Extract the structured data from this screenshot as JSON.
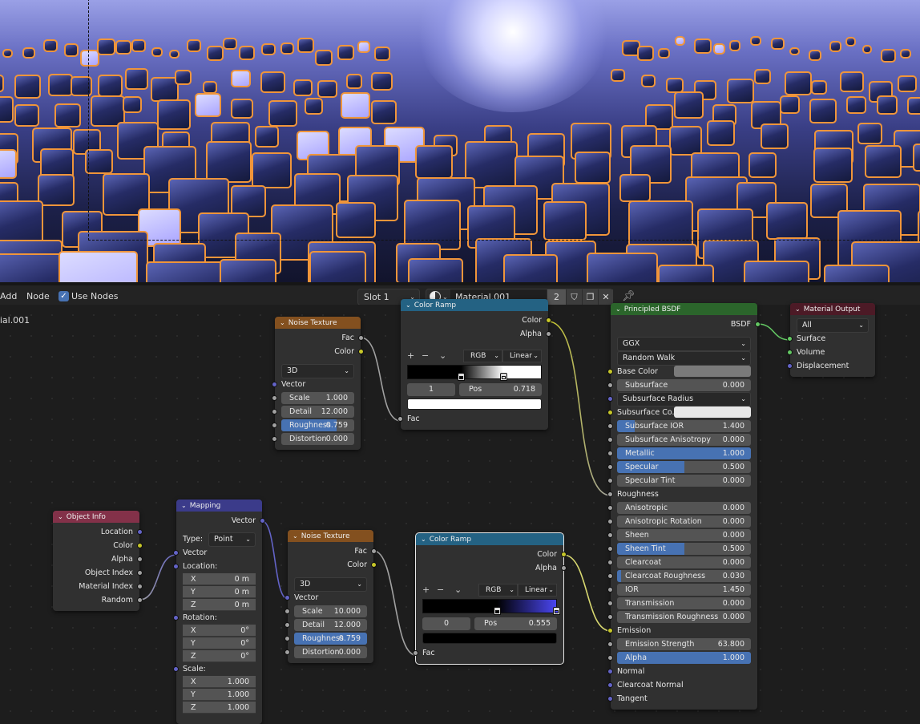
{
  "header": {
    "add": "Add",
    "node": "Node",
    "use_nodes": "Use Nodes",
    "use_nodes_checked": true,
    "slot": "Slot 1",
    "material": "Material.001",
    "users": "2",
    "material_label": "Material.001"
  },
  "colors": {
    "accent": "#4772b3",
    "socket_color": "#c7c729",
    "socket_float": "#a1a1a1",
    "socket_vector": "#6363c7",
    "socket_shader": "#63c763",
    "wire_selected": "#f0953a"
  },
  "nodes": {
    "noise1": {
      "title": "Noise Texture",
      "rows": [
        {
          "t": "out",
          "label": "Fac",
          "s": "float"
        },
        {
          "t": "out",
          "label": "Color",
          "s": "color"
        },
        {
          "t": "spacer"
        },
        {
          "t": "select",
          "value": "3D"
        },
        {
          "t": "in",
          "label": "Vector",
          "s": "vector"
        },
        {
          "t": "field",
          "label": "Scale",
          "value": "1.000",
          "s": "float"
        },
        {
          "t": "field",
          "label": "Detail",
          "value": "12.000",
          "s": "float"
        },
        {
          "t": "field",
          "label": "Roughness",
          "value": "0.759",
          "fill": 0.759,
          "s": "float"
        },
        {
          "t": "field",
          "label": "Distortion",
          "value": "0.000",
          "s": "float"
        }
      ]
    },
    "ramp1": {
      "title": "Color Ramp",
      "rows": [
        {
          "t": "out",
          "label": "Color",
          "s": "color"
        },
        {
          "t": "out",
          "label": "Alpha",
          "s": "float"
        },
        {
          "t": "ramp",
          "mode": "RGB",
          "interp": "Linear",
          "index": "1",
          "pos_label": "Pos",
          "pos": "0.718",
          "stops": [
            {
              "pos": 0.4,
              "color": "#000000"
            },
            {
              "pos": 0.718,
              "color": "#ffffff"
            }
          ],
          "swatch": "#ffffff"
        },
        {
          "t": "in",
          "label": "Fac",
          "s": "float"
        }
      ]
    },
    "bsdf": {
      "title": "Principled BSDF",
      "rows": [
        {
          "t": "out",
          "label": "BSDF",
          "s": "shader"
        },
        {
          "t": "spacer"
        },
        {
          "t": "select",
          "value": "GGX"
        },
        {
          "t": "select",
          "value": "Random Walk"
        },
        {
          "t": "color",
          "label": "Base Color",
          "swatch": "#7a7a7a",
          "s": "color"
        },
        {
          "t": "field",
          "label": "Subsurface",
          "value": "0.000",
          "s": "float"
        },
        {
          "t": "selin",
          "label": "Subsurface Radius",
          "s": "vector"
        },
        {
          "t": "color",
          "label": "Subsurface Co...",
          "swatch": "#e8e8e8",
          "s": "color"
        },
        {
          "t": "field",
          "label": "Subsurface IOR",
          "value": "1.400",
          "fill": 0.13,
          "s": "float"
        },
        {
          "t": "field",
          "label": "Subsurface Anisotropy",
          "value": "0.000",
          "s": "float"
        },
        {
          "t": "field",
          "label": "Metallic",
          "value": "1.000",
          "fill": 1,
          "s": "float"
        },
        {
          "t": "field",
          "label": "Specular",
          "value": "0.500",
          "fill": 0.5,
          "s": "float"
        },
        {
          "t": "field",
          "label": "Specular Tint",
          "value": "0.000",
          "s": "float"
        },
        {
          "t": "in",
          "label": "Roughness",
          "s": "float"
        },
        {
          "t": "field",
          "label": "Anisotropic",
          "value": "0.000",
          "s": "float"
        },
        {
          "t": "field",
          "label": "Anisotropic Rotation",
          "value": "0.000",
          "s": "float"
        },
        {
          "t": "field",
          "label": "Sheen",
          "value": "0.000",
          "s": "float"
        },
        {
          "t": "field",
          "label": "Sheen Tint",
          "value": "0.500",
          "fill": 0.5,
          "s": "float"
        },
        {
          "t": "field",
          "label": "Clearcoat",
          "value": "0.000",
          "s": "float"
        },
        {
          "t": "field",
          "label": "Clearcoat Roughness",
          "value": "0.030",
          "fill": 0.03,
          "s": "float"
        },
        {
          "t": "field",
          "label": "IOR",
          "value": "1.450",
          "s": "float"
        },
        {
          "t": "field",
          "label": "Transmission",
          "value": "0.000",
          "s": "float"
        },
        {
          "t": "field",
          "label": "Transmission Roughness",
          "value": "0.000",
          "s": "float"
        },
        {
          "t": "in",
          "label": "Emission",
          "s": "color"
        },
        {
          "t": "field",
          "label": "Emission Strength",
          "value": "63.800",
          "s": "float"
        },
        {
          "t": "field",
          "label": "Alpha",
          "value": "1.000",
          "fill": 1,
          "s": "float"
        },
        {
          "t": "in",
          "label": "Normal",
          "s": "vector"
        },
        {
          "t": "in",
          "label": "Clearcoat Normal",
          "s": "vector"
        },
        {
          "t": "in",
          "label": "Tangent",
          "s": "vector"
        }
      ]
    },
    "output": {
      "title": "Material Output",
      "rows": [
        {
          "t": "select",
          "value": "All"
        },
        {
          "t": "in",
          "label": "Surface",
          "s": "shader"
        },
        {
          "t": "in",
          "label": "Volume",
          "s": "shader"
        },
        {
          "t": "in",
          "label": "Displacement",
          "s": "vector"
        }
      ]
    },
    "objinfo": {
      "title": "Object Info",
      "rows": [
        {
          "t": "out",
          "label": "Location",
          "s": "vector"
        },
        {
          "t": "out",
          "label": "Color",
          "s": "color"
        },
        {
          "t": "out",
          "label": "Alpha",
          "s": "float"
        },
        {
          "t": "out",
          "label": "Object Index",
          "s": "float"
        },
        {
          "t": "out",
          "label": "Material Index",
          "s": "float"
        },
        {
          "t": "out",
          "label": "Random",
          "s": "float"
        }
      ]
    },
    "mapping": {
      "title": "Mapping",
      "rows": [
        {
          "t": "out",
          "label": "Vector",
          "s": "vector"
        },
        {
          "t": "spacer"
        },
        {
          "t": "type",
          "label": "Type:",
          "value": "Point"
        },
        {
          "t": "in",
          "label": "Vector",
          "s": "vector"
        },
        {
          "t": "label",
          "label": "Location:",
          "s": "vector"
        },
        {
          "t": "xyz",
          "label": "X",
          "value": "0 m"
        },
        {
          "t": "xyz",
          "label": "Y",
          "value": "0 m"
        },
        {
          "t": "xyz",
          "label": "Z",
          "value": "0 m"
        },
        {
          "t": "label",
          "label": "Rotation:",
          "s": "vector"
        },
        {
          "t": "xyz",
          "label": "X",
          "value": "0°"
        },
        {
          "t": "xyz",
          "label": "Y",
          "value": "0°"
        },
        {
          "t": "xyz",
          "label": "Z",
          "value": "0°"
        },
        {
          "t": "label",
          "label": "Scale:",
          "s": "vector"
        },
        {
          "t": "xyz",
          "label": "X",
          "value": "1.000"
        },
        {
          "t": "xyz",
          "label": "Y",
          "value": "1.000"
        },
        {
          "t": "xyz",
          "label": "Z",
          "value": "1.000"
        }
      ]
    },
    "noise2": {
      "title": "Noise Texture",
      "rows": [
        {
          "t": "out",
          "label": "Fac",
          "s": "float"
        },
        {
          "t": "out",
          "label": "Color",
          "s": "color"
        },
        {
          "t": "spacer"
        },
        {
          "t": "select",
          "value": "3D"
        },
        {
          "t": "in",
          "label": "Vector",
          "s": "vector"
        },
        {
          "t": "field",
          "label": "Scale",
          "value": "10.000",
          "s": "float"
        },
        {
          "t": "field",
          "label": "Detail",
          "value": "12.000",
          "s": "float"
        },
        {
          "t": "field",
          "label": "Roughness",
          "value": "0.759",
          "fill": 1,
          "s": "float"
        },
        {
          "t": "field",
          "label": "Distortion",
          "value": "0.000",
          "s": "float"
        }
      ]
    },
    "ramp2": {
      "title": "Color Ramp",
      "selected": true,
      "rows": [
        {
          "t": "out",
          "label": "Color",
          "s": "color"
        },
        {
          "t": "out",
          "label": "Alpha",
          "s": "float"
        },
        {
          "t": "ramp",
          "mode": "RGB",
          "interp": "Linear",
          "index": "0",
          "pos_label": "Pos",
          "pos": "0.555",
          "stops": [
            {
              "pos": 0.555,
              "color": "#000000"
            },
            {
              "pos": 1.0,
              "color": "#4a46f0"
            }
          ],
          "swatch": "#000000"
        },
        {
          "t": "in",
          "label": "Fac",
          "s": "float"
        }
      ]
    }
  }
}
